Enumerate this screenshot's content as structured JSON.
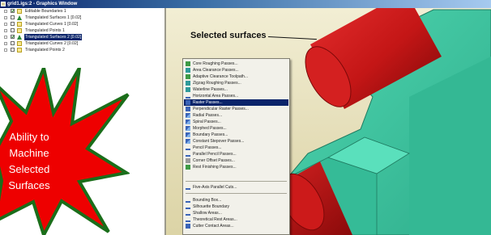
{
  "window": {
    "title": "grid1.igs:2 - Graphics Window"
  },
  "explorer": {
    "items": [
      {
        "label": "Editable Boundaries 1",
        "checked": true,
        "icon": "boundary-icon",
        "selected": false
      },
      {
        "label": "Triangulated Surfaces 1 [0.02]",
        "checked": false,
        "icon": "triangle-icon",
        "selected": false
      },
      {
        "label": "Triangulated Curves 1 [0.02]",
        "checked": false,
        "icon": "curve-icon",
        "selected": false
      },
      {
        "label": "Triangulated Points 1",
        "checked": false,
        "icon": "points-icon",
        "selected": false
      },
      {
        "label": "Triangulated Surfaces 2 [0.02]",
        "checked": true,
        "icon": "triangle-icon",
        "selected": true
      },
      {
        "label": "Triangulated Curves 2 [0.02]",
        "checked": false,
        "icon": "curve-icon",
        "selected": false
      },
      {
        "label": "Triangulated Points 2",
        "checked": false,
        "icon": "points-icon",
        "selected": false
      }
    ]
  },
  "viewport": {
    "annotation": "Selected surfaces",
    "colors": {
      "surface_selected": "#cc1a1a",
      "part_body": "#3cc9a4",
      "background": "#e8e4cc"
    }
  },
  "context_menu": {
    "group1": [
      {
        "label": "Core Roughing Passes...",
        "icon": "green"
      },
      {
        "label": "Area Clearance Passes...",
        "icon": "teal"
      },
      {
        "label": "Adaptive Clearance Toolpath...",
        "icon": "green"
      },
      {
        "label": "Zigzag Roughing Passes...",
        "icon": "teal"
      },
      {
        "label": "Waterline Passes...",
        "icon": "teal"
      },
      {
        "label": "Horizontal Area Passes...",
        "icon": "flat"
      },
      {
        "label": "Raster Passes...",
        "icon": "blue",
        "highlighted": true
      },
      {
        "label": "Perpendicular Raster Passes...",
        "icon": "blue"
      },
      {
        "label": "Radial Passes...",
        "icon": "wave"
      },
      {
        "label": "Spiral Passes...",
        "icon": "wave"
      },
      {
        "label": "Morphed Passes...",
        "icon": "wave"
      },
      {
        "label": "Boundary Passes...",
        "icon": "wave"
      },
      {
        "label": "Constant Stepover Passes...",
        "icon": "wave"
      },
      {
        "label": "Pencil Passes...",
        "icon": "flat"
      },
      {
        "label": "Parallel Pencil Passes...",
        "icon": "flat"
      },
      {
        "label": "Corner Offset Passes...",
        "icon": "grey"
      },
      {
        "label": "Rest Finishing Passes...",
        "icon": "green"
      }
    ],
    "group2": [
      {
        "label": "Five-Axis Parallel Cuts...",
        "icon": "flat"
      }
    ],
    "group3": [
      {
        "label": "Bounding Box...",
        "icon": "flat"
      },
      {
        "label": "Silhouette Boundary",
        "icon": "flat"
      },
      {
        "label": "Shallow Areas...",
        "icon": "flat"
      },
      {
        "label": "Theoretical Rest Areas...",
        "icon": "flat"
      },
      {
        "label": "Cutter Contact Areas...",
        "icon": "blue"
      }
    ]
  },
  "callout": {
    "lines": [
      "Ability to",
      "Machine",
      "Selected",
      "Surfaces"
    ],
    "fill": "#ee0000",
    "stroke": "#1a6e1a"
  }
}
